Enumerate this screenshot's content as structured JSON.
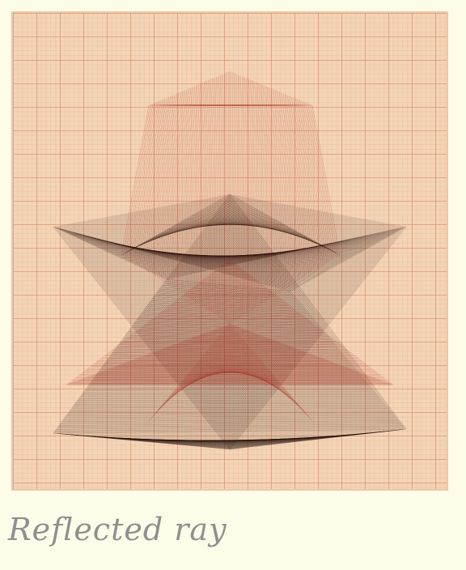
{
  "caption": "Reflected ray",
  "colors": {
    "background": "#fdfce8",
    "paper": "#f3d4b6",
    "grid_fine": "#e6a98a",
    "grid_bold": "#dc9474",
    "ink_dark": "#1e0a05",
    "ink_red": "#a01008"
  },
  "icons": []
}
